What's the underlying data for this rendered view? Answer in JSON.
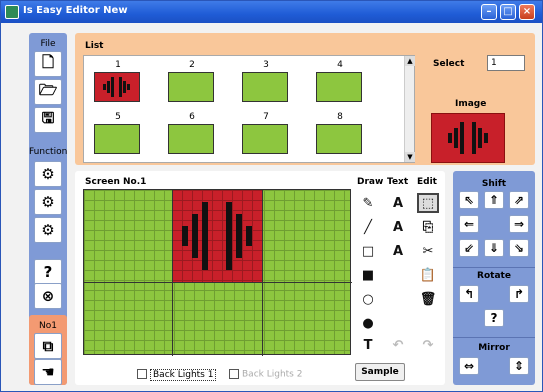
{
  "window": {
    "title": "Is Easy Editor  New",
    "minimize": "–",
    "maximize": "□",
    "close": "×"
  },
  "left": {
    "file_label": "File",
    "file_buttons": [
      {
        "icon": "new-icon",
        "glyph": "🗋"
      },
      {
        "icon": "open-icon",
        "glyph": "🗁"
      },
      {
        "icon": "save-icon",
        "glyph": "🖫"
      }
    ],
    "function_label": "Function",
    "function_buttons": [
      {
        "icon": "function-1-icon",
        "glyph": "⚙"
      },
      {
        "icon": "function-2-icon",
        "glyph": "⚙"
      },
      {
        "icon": "function-3-icon",
        "glyph": "⚙"
      }
    ],
    "help_glyph": "?",
    "exit_glyph": "⊗",
    "no_label": "No1",
    "no_buttons": [
      {
        "icon": "copy-icon",
        "glyph": "⧉"
      },
      {
        "icon": "hand-icon",
        "glyph": "☚"
      }
    ]
  },
  "list": {
    "label": "List",
    "items": [
      "1",
      "2",
      "3",
      "4",
      "5",
      "6",
      "7",
      "8"
    ],
    "active_index": 0,
    "scroll_up": "▲",
    "scroll_down": "▼",
    "select_label": "Select",
    "select_value": "1",
    "image_label": "Image"
  },
  "editor": {
    "screen_label": "Screen No.1",
    "draw_label": "Draw",
    "text_label": "Text",
    "edit_label": "Edit",
    "draw_tools": [
      {
        "name": "pencil-icon",
        "glyph": "✎"
      },
      {
        "name": "line-icon",
        "glyph": "╱"
      },
      {
        "name": "rect-outline-icon",
        "glyph": "□"
      },
      {
        "name": "rect-fill-icon",
        "glyph": "■"
      },
      {
        "name": "ellipse-outline-icon",
        "glyph": "○"
      },
      {
        "name": "ellipse-fill-icon",
        "glyph": "●"
      },
      {
        "name": "text-insert-icon",
        "glyph": "T"
      }
    ],
    "text_tools": [
      {
        "name": "text-font-a-icon",
        "glyph": "A"
      },
      {
        "name": "text-size-12-icon",
        "glyph": "A"
      },
      {
        "name": "text-size-16-icon",
        "glyph": "A"
      }
    ],
    "edit_tools": [
      {
        "name": "select-icon",
        "glyph": "⬚"
      },
      {
        "name": "copy-icon",
        "glyph": "⎘"
      },
      {
        "name": "cut-icon",
        "glyph": "✂"
      },
      {
        "name": "paste-icon",
        "glyph": "📋"
      },
      {
        "name": "delete-icon",
        "glyph": "🗑"
      }
    ],
    "undo_glyph": "↶",
    "redo_glyph": "↷",
    "backlight1_label": "Back Lights 1",
    "backlight2_label": "Back Lights 2",
    "sample_label": "Sample"
  },
  "right": {
    "shift_label": "Shift",
    "shift_buttons": [
      {
        "name": "shift-up-left-icon",
        "glyph": "⇖"
      },
      {
        "name": "shift-up-icon",
        "glyph": "⇑"
      },
      {
        "name": "shift-up-right-icon",
        "glyph": "⇗"
      },
      {
        "name": "shift-left-icon",
        "glyph": "⇐"
      },
      {
        "name": "shift-right-icon",
        "glyph": "⇒"
      },
      {
        "name": "shift-down-left-icon",
        "glyph": "⇙"
      },
      {
        "name": "shift-down-icon",
        "glyph": "⇓"
      },
      {
        "name": "shift-down-right-icon",
        "glyph": "⇘"
      }
    ],
    "rotate_label": "Rotate",
    "rotate_left_glyph": "↰",
    "rotate_right_glyph": "↱",
    "rotate_help_glyph": "?",
    "mirror_label": "Mirror",
    "mirror_h_glyph": "⇔",
    "mirror_v_glyph": "⇕"
  },
  "colors": {
    "lcd_green": "#8dc63f",
    "lcd_red": "#c8202a",
    "panel_blue": "#7f9ad6",
    "panel_orange": "#f9c79a"
  }
}
